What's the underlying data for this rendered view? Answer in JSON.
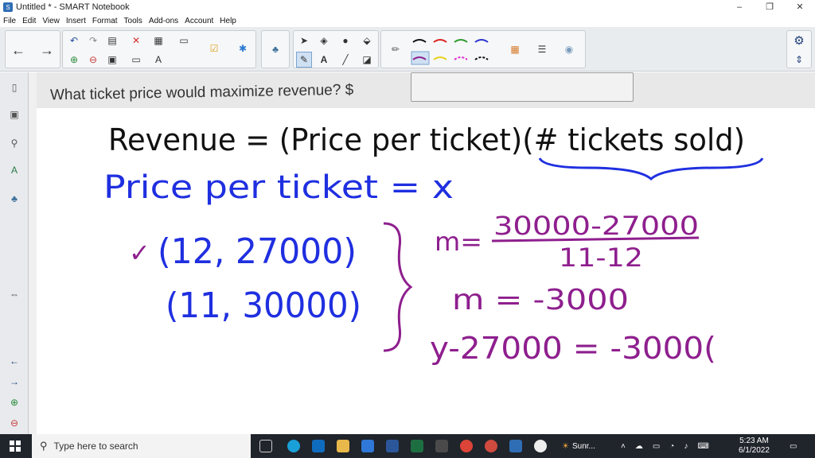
{
  "window": {
    "title": "Untitled * - SMART Notebook",
    "min": "–",
    "max": "❐",
    "close": "✕"
  },
  "menu": [
    "File",
    "Edit",
    "View",
    "Insert",
    "Format",
    "Tools",
    "Add-ons",
    "Account",
    "Help"
  ],
  "question": {
    "text": "What ticket price would maximize revenue? $",
    "answer_value": ""
  },
  "handwriting": {
    "line1": "Revenue = (Price per ticket)(# tickets sold)",
    "line2": "Price per ticket = x",
    "point1": "(12, 27000)",
    "point2": "(11, 30000)",
    "checkmark": "✓",
    "slope_label": "m=",
    "slope_numerator": "30000-27000",
    "slope_denominator": "11-12",
    "slope_result": "m = -3000",
    "point_slope": "y-27000 = -3000("
  },
  "colors": {
    "black_ink": "#111111",
    "blue_ink": "#1f2fe0",
    "purple_ink": "#8e1f8e"
  },
  "taskbar": {
    "search_placeholder": "Type here to search",
    "weather": "Sunr...",
    "time": "5:23 AM",
    "date": "6/1/2022"
  }
}
